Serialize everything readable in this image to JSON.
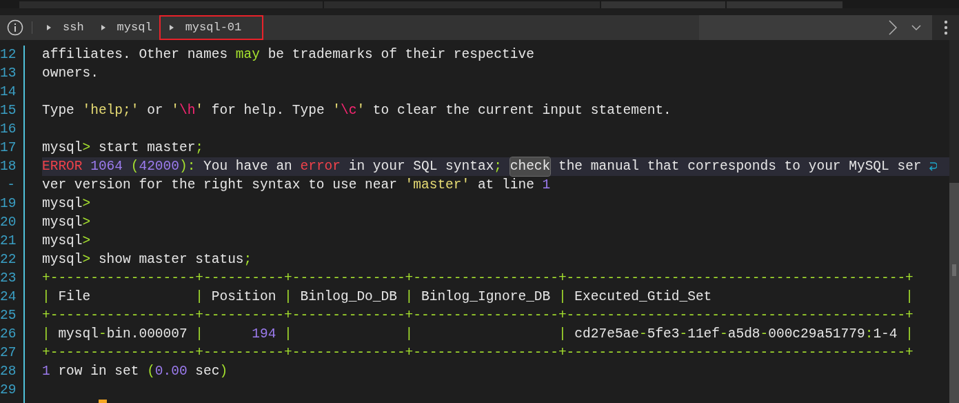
{
  "breadcrumb": [
    {
      "label": "ssh",
      "highlighted": false
    },
    {
      "label": "mysql",
      "highlighted": false
    },
    {
      "label": "mysql-01",
      "highlighted": true
    }
  ],
  "terminal": {
    "lines": [
      {
        "number": "12",
        "current": false,
        "wrapped": false,
        "segments": [
          {
            "text": "affiliates. Other names ",
            "kind": "text"
          },
          {
            "text": "may",
            "kind": "keyword"
          },
          {
            "text": " be trademarks of their respective",
            "kind": "text"
          }
        ]
      },
      {
        "number": "13",
        "current": false,
        "wrapped": false,
        "segments": [
          {
            "text": "owners.",
            "kind": "text"
          }
        ]
      },
      {
        "number": "14"
      },
      {
        "number": "15",
        "current": false,
        "wrapped": false,
        "segments": [
          {
            "text": "Type ",
            "kind": "text"
          },
          {
            "text": "'help;'",
            "kind": "string"
          },
          {
            "text": " or ",
            "kind": "text"
          },
          {
            "text": "'",
            "kind": "string"
          },
          {
            "text": "\\h",
            "kind": "escape"
          },
          {
            "text": "'",
            "kind": "string"
          },
          {
            "text": " for help. Type ",
            "kind": "text"
          },
          {
            "text": "'",
            "kind": "string"
          },
          {
            "text": "\\c",
            "kind": "escape"
          },
          {
            "text": "'",
            "kind": "string"
          },
          {
            "text": " to clear the current input statement.",
            "kind": "text"
          }
        ]
      },
      {
        "number": "16"
      },
      {
        "number": "17",
        "current": false,
        "wrapped": false,
        "segments": [
          {
            "text": "mysql",
            "kind": "text"
          },
          {
            "text": ">",
            "kind": "punct"
          },
          {
            "text": " start master",
            "kind": "text"
          },
          {
            "text": ";",
            "kind": "punct"
          }
        ]
      },
      {
        "number": "18",
        "current": true,
        "wrapped": true,
        "segments": [
          {
            "text": "ERROR",
            "kind": "error"
          },
          {
            "text": " 1064",
            "kind": "number"
          },
          {
            "text": " (",
            "kind": "punct"
          },
          {
            "text": "42000",
            "kind": "number"
          },
          {
            "text": "):",
            "kind": "punct"
          },
          {
            "text": " You have an ",
            "kind": "text"
          },
          {
            "text": "error",
            "kind": "error"
          },
          {
            "text": " in your SQL syntax",
            "kind": "text"
          },
          {
            "text": "; ",
            "kind": "punct"
          },
          {
            "text": "check",
            "kind": "match"
          },
          {
            "text": " the manual that corresponds to your MySQL ser",
            "kind": "text"
          }
        ]
      },
      {
        "number": "-",
        "current": false,
        "wrapped": false,
        "segments": [
          {
            "text": "ver version for the right syntax to use near ",
            "kind": "text"
          },
          {
            "text": "'master'",
            "kind": "string"
          },
          {
            "text": " at line ",
            "kind": "text"
          },
          {
            "text": "1",
            "kind": "number"
          }
        ]
      },
      {
        "number": "19",
        "current": false,
        "wrapped": false,
        "segments": [
          {
            "text": "mysql",
            "kind": "text"
          },
          {
            "text": ">",
            "kind": "punct"
          }
        ]
      },
      {
        "number": "20",
        "current": false,
        "wrapped": false,
        "segments": [
          {
            "text": "mysql",
            "kind": "text"
          },
          {
            "text": ">",
            "kind": "punct"
          }
        ]
      },
      {
        "number": "21",
        "current": false,
        "wrapped": false,
        "segments": [
          {
            "text": "mysql",
            "kind": "text"
          },
          {
            "text": ">",
            "kind": "punct"
          }
        ]
      },
      {
        "number": "22",
        "current": false,
        "wrapped": false,
        "segments": [
          {
            "text": "mysql",
            "kind": "text"
          },
          {
            "text": ">",
            "kind": "punct"
          },
          {
            "text": " show master status",
            "kind": "text"
          },
          {
            "text": ";",
            "kind": "punct"
          }
        ]
      },
      {
        "number": "23",
        "current": false,
        "wrapped": false,
        "segments": [
          {
            "text": "+------------------+----------+--------------+------------------+------------------------------------------+",
            "kind": "border"
          }
        ]
      },
      {
        "number": "24",
        "current": false,
        "wrapped": false,
        "segments": [
          {
            "text": "|",
            "kind": "border"
          },
          {
            "text": " File             ",
            "kind": "text"
          },
          {
            "text": "|",
            "kind": "border"
          },
          {
            "text": " Position ",
            "kind": "text"
          },
          {
            "text": "|",
            "kind": "border"
          },
          {
            "text": " Binlog_Do_DB ",
            "kind": "text"
          },
          {
            "text": "|",
            "kind": "border"
          },
          {
            "text": " Binlog_Ignore_DB ",
            "kind": "text"
          },
          {
            "text": "|",
            "kind": "border"
          },
          {
            "text": " Executed_Gtid_Set                        ",
            "kind": "text"
          },
          {
            "text": "|",
            "kind": "border"
          }
        ]
      },
      {
        "number": "25",
        "current": false,
        "wrapped": false,
        "segments": [
          {
            "text": "+------------------+----------+--------------+------------------+------------------------------------------+",
            "kind": "border"
          }
        ]
      },
      {
        "number": "26",
        "current": false,
        "wrapped": false,
        "segments": [
          {
            "text": "|",
            "kind": "border"
          },
          {
            "text": " mysql",
            "kind": "text"
          },
          {
            "text": "-",
            "kind": "punct"
          },
          {
            "text": "bin.000007 ",
            "kind": "text"
          },
          {
            "text": "|",
            "kind": "border"
          },
          {
            "text": "      194 ",
            "kind": "number"
          },
          {
            "text": "|              |                  |",
            "kind": "border"
          },
          {
            "text": " cd27e5ae",
            "kind": "text"
          },
          {
            "text": "-",
            "kind": "punct"
          },
          {
            "text": "5fe3",
            "kind": "text"
          },
          {
            "text": "-",
            "kind": "punct"
          },
          {
            "text": "11ef",
            "kind": "text"
          },
          {
            "text": "-",
            "kind": "punct"
          },
          {
            "text": "a5d8",
            "kind": "text"
          },
          {
            "text": "-",
            "kind": "punct"
          },
          {
            "text": "000c29a51779",
            "kind": "text"
          },
          {
            "text": ":",
            "kind": "punct"
          },
          {
            "text": "1-4 ",
            "kind": "text"
          },
          {
            "text": "|",
            "kind": "border"
          }
        ]
      },
      {
        "number": "27",
        "current": false,
        "wrapped": false,
        "segments": [
          {
            "text": "+------------------+----------+--------------+------------------+------------------------------------------+",
            "kind": "border"
          }
        ]
      },
      {
        "number": "28",
        "current": false,
        "wrapped": false,
        "segments": [
          {
            "text": "1",
            "kind": "number"
          },
          {
            "text": " row in set ",
            "kind": "text"
          },
          {
            "text": "(",
            "kind": "punct"
          },
          {
            "text": "0.00",
            "kind": "number"
          },
          {
            "text": " sec",
            "kind": "text"
          },
          {
            "text": ")",
            "kind": "punct"
          }
        ]
      },
      {
        "number": "29"
      }
    ]
  }
}
